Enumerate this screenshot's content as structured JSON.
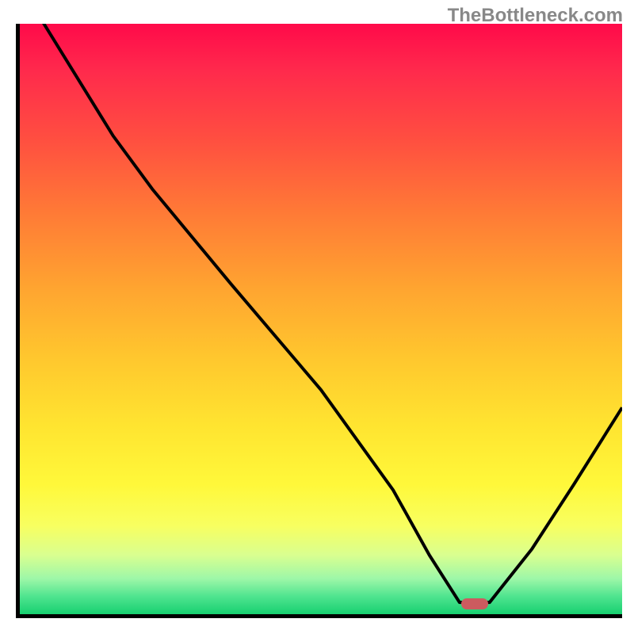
{
  "watermark": "TheBottleneck.com",
  "chart_data": {
    "type": "line",
    "title": "",
    "xlabel": "",
    "ylabel": "",
    "x": [
      0.0,
      0.04,
      0.155,
      0.22,
      0.35,
      0.5,
      0.62,
      0.68,
      0.73,
      0.78,
      0.85,
      0.92,
      1.0
    ],
    "y": [
      1.07,
      1.0,
      0.81,
      0.72,
      0.56,
      0.38,
      0.21,
      0.1,
      0.02,
      0.02,
      0.11,
      0.22,
      0.35
    ],
    "xlim": [
      0,
      1
    ],
    "ylim": [
      0,
      1
    ],
    "legend": null,
    "marker": {
      "x": 0.755,
      "y": 0.018,
      "color": "#cc5b5f"
    }
  },
  "gradient_colors": {
    "top": "#ff0a4a",
    "mid": "#ffd030",
    "bottom": "#17d070"
  }
}
